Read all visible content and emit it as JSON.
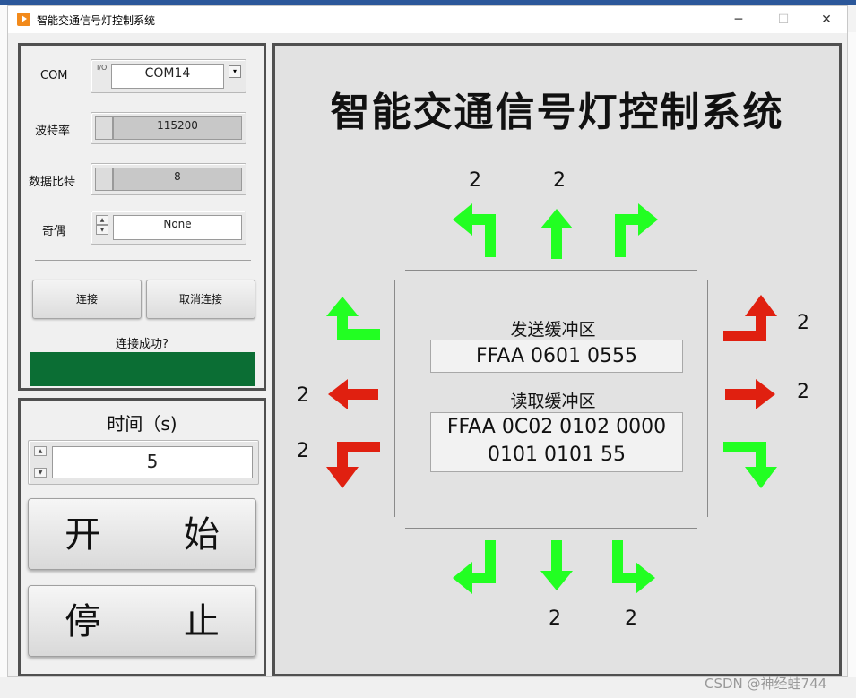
{
  "window": {
    "title": "智能交通信号灯控制系统",
    "minimize": "─",
    "maximize": "☐",
    "close": "✕"
  },
  "colors": {
    "green": "#22ff22",
    "red": "#e02010",
    "led": "#0b6e34"
  },
  "serial": {
    "com_label": "COM",
    "com_value": "COM14",
    "com_io_glyph": "I/O",
    "baud_label": "波特率",
    "baud_value": "115200",
    "databits_label": "数据比特",
    "databits_value": "8",
    "parity_label": "奇偶",
    "parity_value": "None",
    "connect_label": "连接",
    "disconnect_label": "取消连接",
    "status_label": "连接成功?"
  },
  "timer": {
    "label": "时间（s)",
    "value": "5",
    "start_label": "开 始",
    "stop_label": "停 止"
  },
  "display": {
    "title": "智能交通信号灯控制系统",
    "send_label": "发送缓冲区",
    "send_value": "FFAA 0601 0555",
    "read_label": "读取缓冲区",
    "read_line1": "FFAA 0C02 0102 0000",
    "read_line2": "0101 0101 55",
    "north_left_count": "2",
    "north_straight_count": "2",
    "east_left_count": "2",
    "east_straight_count": "2",
    "west_straight_count": "2",
    "west_right_count": "2",
    "south_straight_count": "2",
    "south_right_count": "2"
  },
  "arrows": {
    "north_left": "green",
    "north_straight": "green",
    "north_right": "green",
    "east_left": "red",
    "east_straight": "red",
    "east_right": "green",
    "west_left": "green",
    "west_straight": "red",
    "west_right": "red",
    "south_left": "green",
    "south_straight": "green",
    "south_right": "green"
  },
  "watermark": "CSDN @神经蛙744"
}
